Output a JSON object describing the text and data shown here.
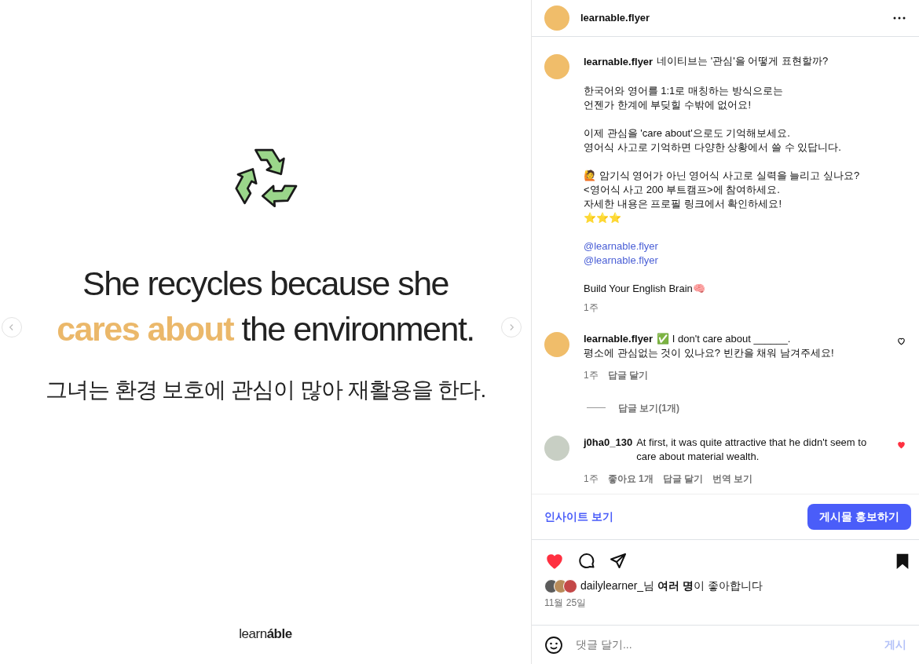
{
  "slide": {
    "headline_lines": [
      "She recycles because she",
      "**cares about** the environment."
    ],
    "translation": "그녀는 환경 보호에 관심이 많아 재활용을 한다.",
    "logo": "learn**áble**"
  },
  "header": {
    "username": "learnable.flyer"
  },
  "caption": {
    "username": "learnable.flyer",
    "paragraphs": [
      {
        "kind": "text",
        "lines": [
          "네이티브는 '관심'을 어떻게 표현할까?"
        ]
      },
      {
        "kind": "text",
        "lines": [
          "한국어와 영어를 1:1로 매칭하는 방식으로는",
          "언젠가 한계에 부딪힐 수밖에 없어요!"
        ]
      },
      {
        "kind": "text",
        "lines": [
          "이제 관심을 'care about'으로도 기억해보세요.",
          "영어식 사고로 기억하면 다양한 상황에서 쓸 수 있답니다."
        ]
      },
      {
        "kind": "text",
        "lines": [
          "🙋 암기식 영어가 아닌 영어식 사고로 실력을 늘리고 싶나요?",
          "<영어식 사고 200 부트캠프>에 참여하세요.",
          "자세한 내용은 프로필 링크에서 확인하세요!",
          "⭐⭐⭐"
        ]
      },
      {
        "kind": "mentions",
        "lines": [
          "@learnable.flyer",
          "@learnable.flyer"
        ]
      },
      {
        "kind": "text",
        "lines": [
          "Build Your English Brain🧠"
        ]
      }
    ],
    "time": "1주"
  },
  "comments": [
    {
      "username": "learnable.flyer",
      "kind": "logo",
      "lines": [
        "✅ I don't care about ______.",
        "평소에 관심없는 것이 있나요? 빈칸을 채워 남겨주세요!"
      ],
      "liked": false,
      "meta": [
        "1주",
        "답글 달기"
      ],
      "replies": "답글 보기(1개)"
    },
    {
      "username": "j0ha0_130",
      "kind": "photo",
      "lines": [
        "At first, it was quite attractive that he didn't seem to care about material wealth."
      ],
      "liked": true,
      "meta": [
        "1주",
        "좋아요 1개",
        "답글 달기",
        "번역 보기"
      ]
    }
  ],
  "promo": {
    "insights": "인사이트 보기",
    "promote": "게시물 홍보하기"
  },
  "actions": {
    "liked": true,
    "saved": true
  },
  "likes": "dailylearner_님 **여러 명**이 좋아합니다",
  "date": "11월 25일",
  "comment_box": {
    "placeholder": "댓글 달기...",
    "post": "게시"
  }
}
